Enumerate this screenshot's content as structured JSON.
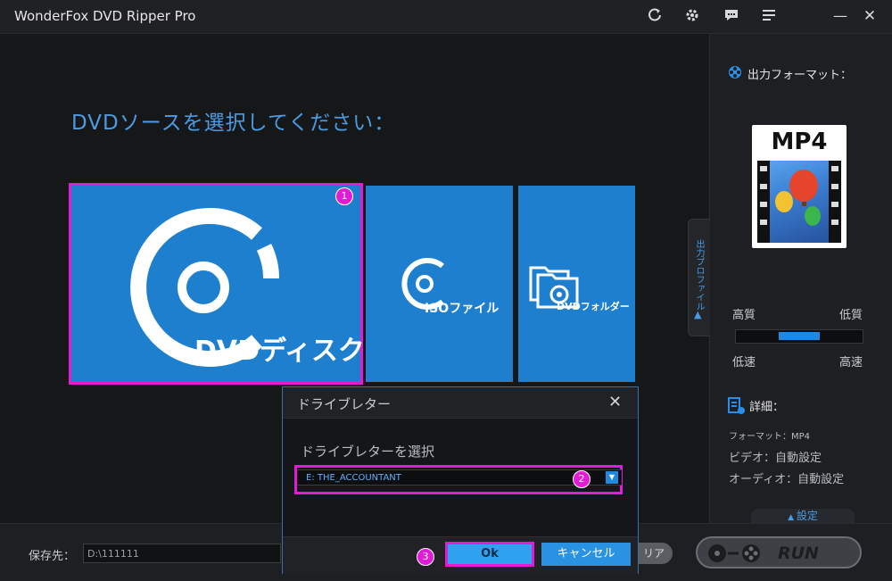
{
  "app": {
    "title": "WonderFox DVD Ripper Pro"
  },
  "titlebar": {
    "icons": [
      "refresh-icon",
      "gear-icon",
      "chat-icon",
      "menu-icon",
      "minimize-icon",
      "close-icon"
    ],
    "minimize_glyph": "—",
    "close_glyph": "✕"
  },
  "main": {
    "heading": "DVDソースを選択してください：",
    "tiles": [
      {
        "label": "DVDディスク",
        "badge": "1"
      },
      {
        "label": "ISOファイル"
      },
      {
        "label": "DVDフォルダー"
      }
    ]
  },
  "sidebar": {
    "tab_label": "出力プロファイル",
    "output_format_title": "出力フォーマット：",
    "format": "MP4",
    "quality": {
      "high_quality": "高質",
      "low_quality": "低質",
      "low_speed": "低速",
      "high_speed": "高速",
      "level": 0.5
    },
    "details_title": "詳細：",
    "format_line": "フォーマット：MP4",
    "video_line": "ビデオ：自動設定",
    "audio_line": "オーディオ：自動設定",
    "settings_label": "設定"
  },
  "bottom": {
    "save_label": "保存先：",
    "save_path": "D:\\111111",
    "clear_label": "リア",
    "run_label": "RUN"
  },
  "dialog": {
    "title": "ドライブレター",
    "prompt": "ドライブレターを選択",
    "selected_drive": "E:  THE_ACCOUNTANT",
    "badge_drive": "2",
    "ok_label": "Ok",
    "badge_ok": "3",
    "cancel_label": "キャンセル"
  },
  "colors": {
    "accent": "#1f7fcf",
    "highlight": "#e21bd6"
  }
}
